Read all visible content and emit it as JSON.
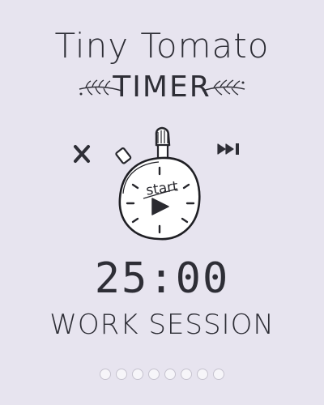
{
  "app": {
    "title": "Tiny Tomato",
    "subtitle": "TIMER"
  },
  "controls": {
    "close_icon": "close-icon",
    "skip_icon": "skip-forward-icon"
  },
  "timer": {
    "start_label": "start",
    "time_remaining": "25:00",
    "session_label": "WORK SESSION"
  },
  "progress": {
    "total_sessions": 8,
    "completed_sessions": 0
  },
  "colors": {
    "background": "#e7e4ef",
    "ink": "#2e2e36",
    "dot_fill": "#f6f5f9",
    "dot_border": "#c6c3cf"
  }
}
